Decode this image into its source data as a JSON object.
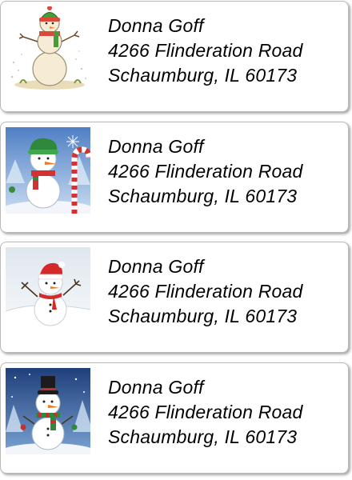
{
  "labels": [
    {
      "name": "Donna Goff",
      "street": "4266 Flinderation Road",
      "city_line": "Schaumburg, IL  60173",
      "art": "snowman-green-hat-icon"
    },
    {
      "name": "Donna Goff",
      "street": "4266 Flinderation Road",
      "city_line": "Schaumburg, IL  60173",
      "art": "snowman-candy-cane-icon"
    },
    {
      "name": "Donna Goff",
      "street": "4266 Flinderation Road",
      "city_line": "Schaumburg, IL  60173",
      "art": "snowman-red-hat-icon"
    },
    {
      "name": "Donna Goff",
      "street": "4266 Flinderation Road",
      "city_line": "Schaumburg, IL  60173",
      "art": "snowman-top-hat-icon"
    }
  ],
  "colors": {
    "label_border": "#b9b9b9",
    "text": "#000000"
  }
}
